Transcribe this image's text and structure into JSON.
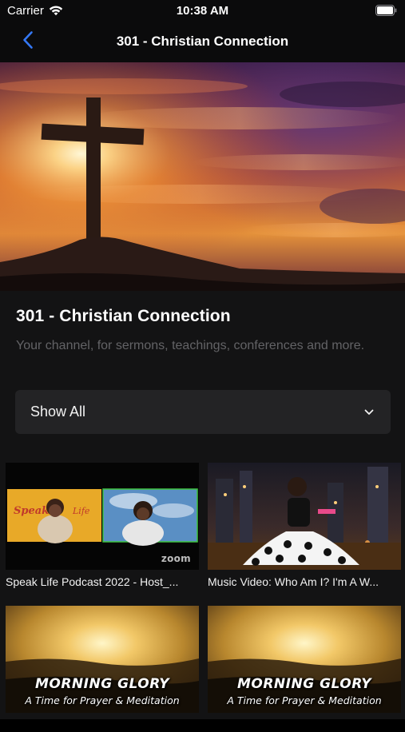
{
  "status_bar": {
    "carrier": "Carrier",
    "time": "10:38 AM",
    "wifi_icon": "wifi-icon",
    "battery_icon": "battery-icon"
  },
  "nav": {
    "back_icon": "chevron-left-icon",
    "title": "301 - Christian Connection",
    "accent_color": "#3478f6"
  },
  "channel": {
    "title": "301 - Christian Connection",
    "description": "Your channel, for sermons, teachings, conferences and more."
  },
  "filter": {
    "selected": "Show All",
    "icon": "chevron-down-icon"
  },
  "videos": [
    {
      "title": "Speak Life Podcast 2022 - Host_...",
      "thumb_overlay": "zoom"
    },
    {
      "title": "Music Video: Who Am I? I'm A W..."
    },
    {
      "title": "",
      "thumb_title": "MORNING GLORY",
      "thumb_subtitle": "A Time for Prayer & Meditation"
    },
    {
      "title": "",
      "thumb_title": "MORNING GLORY",
      "thumb_subtitle": "A Time for Prayer & Meditation"
    }
  ],
  "colors": {
    "background": "#000000",
    "content_background": "#131314",
    "select_background": "#232325",
    "secondary_text": "#636366"
  }
}
